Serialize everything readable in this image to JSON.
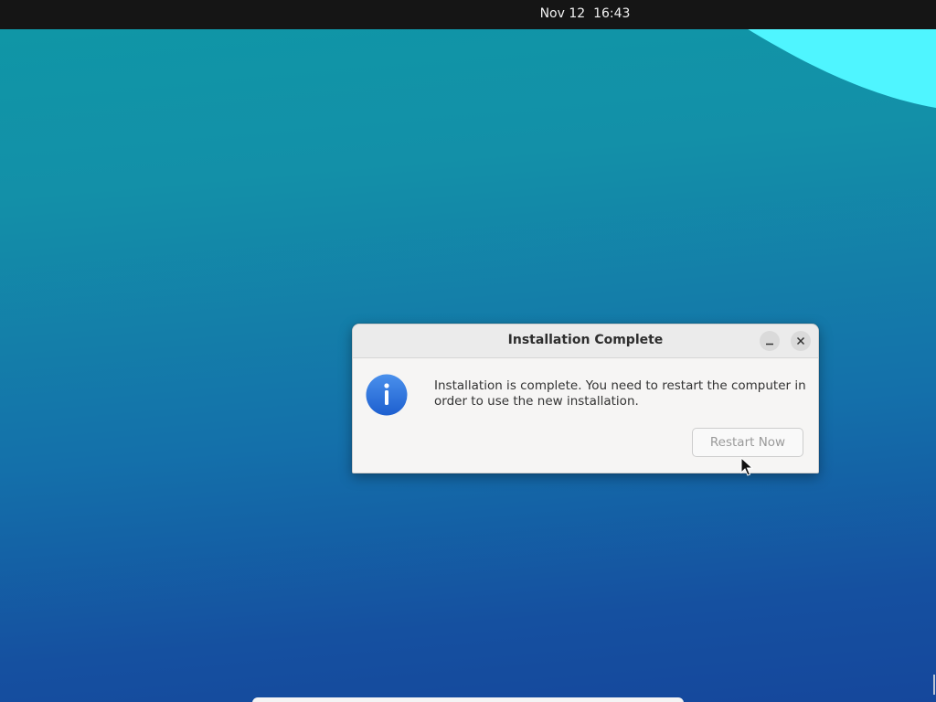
{
  "top_bar": {
    "clock": "Nov 12  16:43"
  },
  "dialog": {
    "title": "Installation Complete",
    "minimize_icon": "minimize-icon",
    "close_icon": "close-icon",
    "info_icon": "info-icon",
    "message": "Installation is complete. You need to restart the computer in order to use the new installation.",
    "restart_button_label": "Restart Now",
    "restart_button_state": "disabled"
  },
  "desktop": {
    "wallpaper_colors": [
      "#0f97a6",
      "#1470aa",
      "#15479c"
    ],
    "accent_wave_color": "#4ff5ff"
  },
  "colors": {
    "top_bar_bg": "#151515",
    "info_icon_blue": "#2a6fdb",
    "dialog_bg": "#f6f5f4"
  }
}
